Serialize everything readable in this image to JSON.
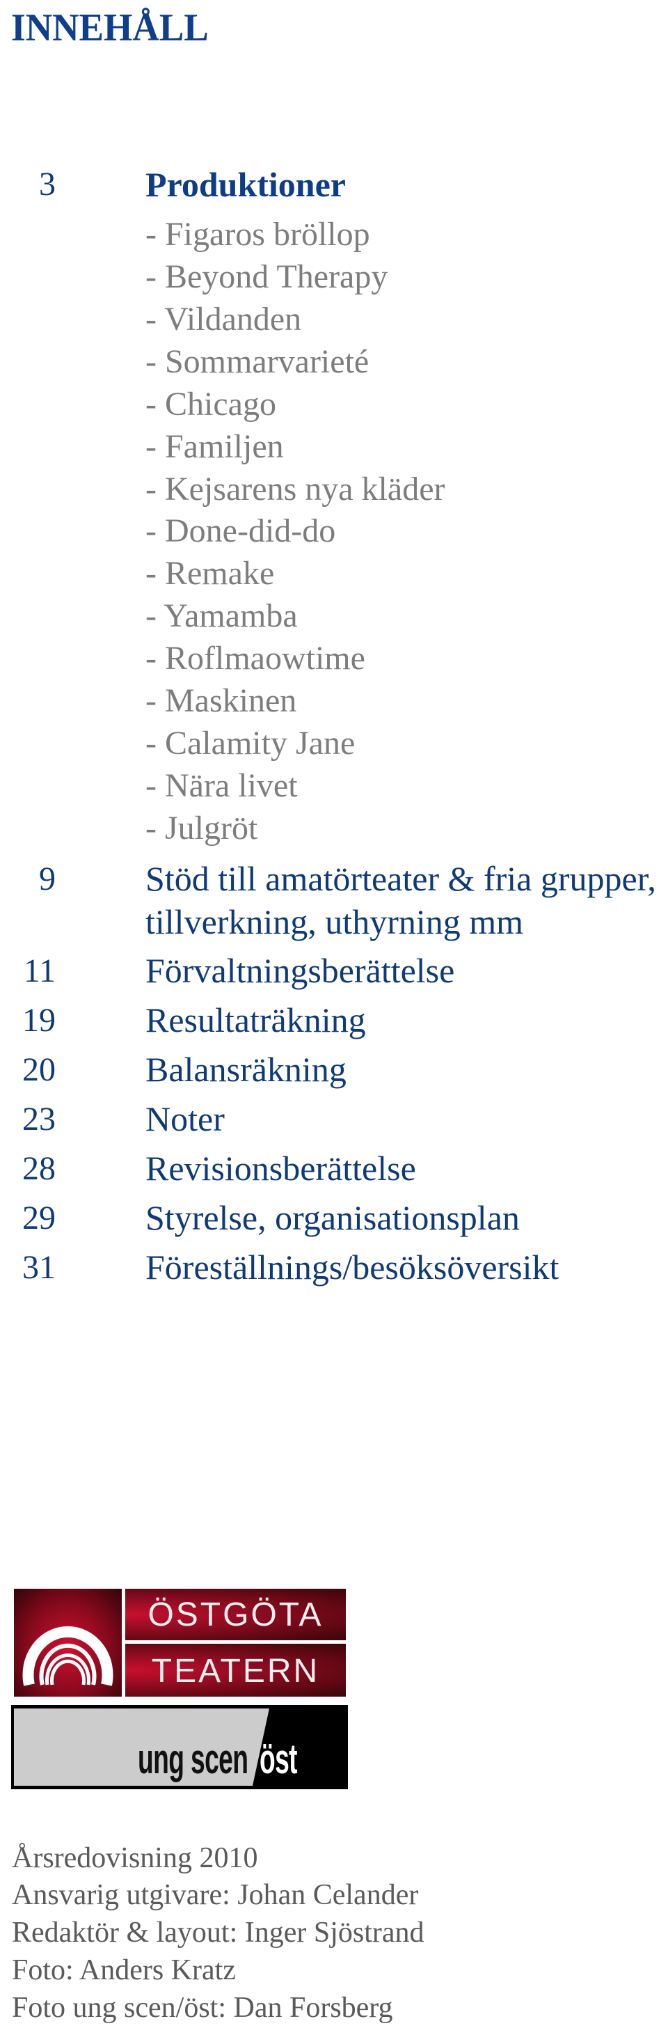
{
  "page": {
    "title": "INNEHÅLL"
  },
  "toc": {
    "productions": {
      "page": "3",
      "heading": "Produktioner",
      "items": [
        "- Figaros bröllop",
        "- Beyond Therapy",
        "- Vildanden",
        "- Sommarvarieté",
        "- Chicago",
        "- Familjen",
        "- Kejsarens nya kläder",
        "- Done-did-do",
        "- Remake",
        "- Yamamba",
        "- Roflmaowtime",
        "- Maskinen",
        "- Calamity Jane",
        "- Nära livet",
        "- Julgröt"
      ]
    },
    "entries": [
      {
        "page": "9",
        "text": "Stöd till amatörteater & fria grupper,",
        "text_cont": "tillverkning, uthyrning mm"
      },
      {
        "page": "11",
        "text": "Förvaltningsberättelse"
      },
      {
        "page": "19",
        "text": "Resultaträkning"
      },
      {
        "page": "20",
        "text": "Balansräkning"
      },
      {
        "page": "23",
        "text": "Noter"
      },
      {
        "page": "28",
        "text": "Revisionsberättelse"
      },
      {
        "page": "29",
        "text": "Styrelse, organisationsplan"
      },
      {
        "page": "31",
        "text": "Föreställnings/besöksöversikt"
      }
    ]
  },
  "logos": {
    "ostgota_line1": "ÖSTGÖTA",
    "ostgota_line2": "TEATERN",
    "ungscen_left": "ung scen",
    "ungscen_right": "öst"
  },
  "footer": {
    "lines": [
      "Årsredovisning 2010",
      "Ansvarig utgivare: Johan Celander",
      "Redaktör & layout: Inger Sjöstrand",
      "Foto: Anders Kratz",
      "Foto ung scen/öst: Dan Forsberg"
    ]
  },
  "colors": {
    "heading_blue": "#0e3c86",
    "entry_blue": "#0f3a78",
    "subitem_gray": "#7d7d7d",
    "footer_gray": "#5a5a5a",
    "logo_red": "#c8102e"
  }
}
